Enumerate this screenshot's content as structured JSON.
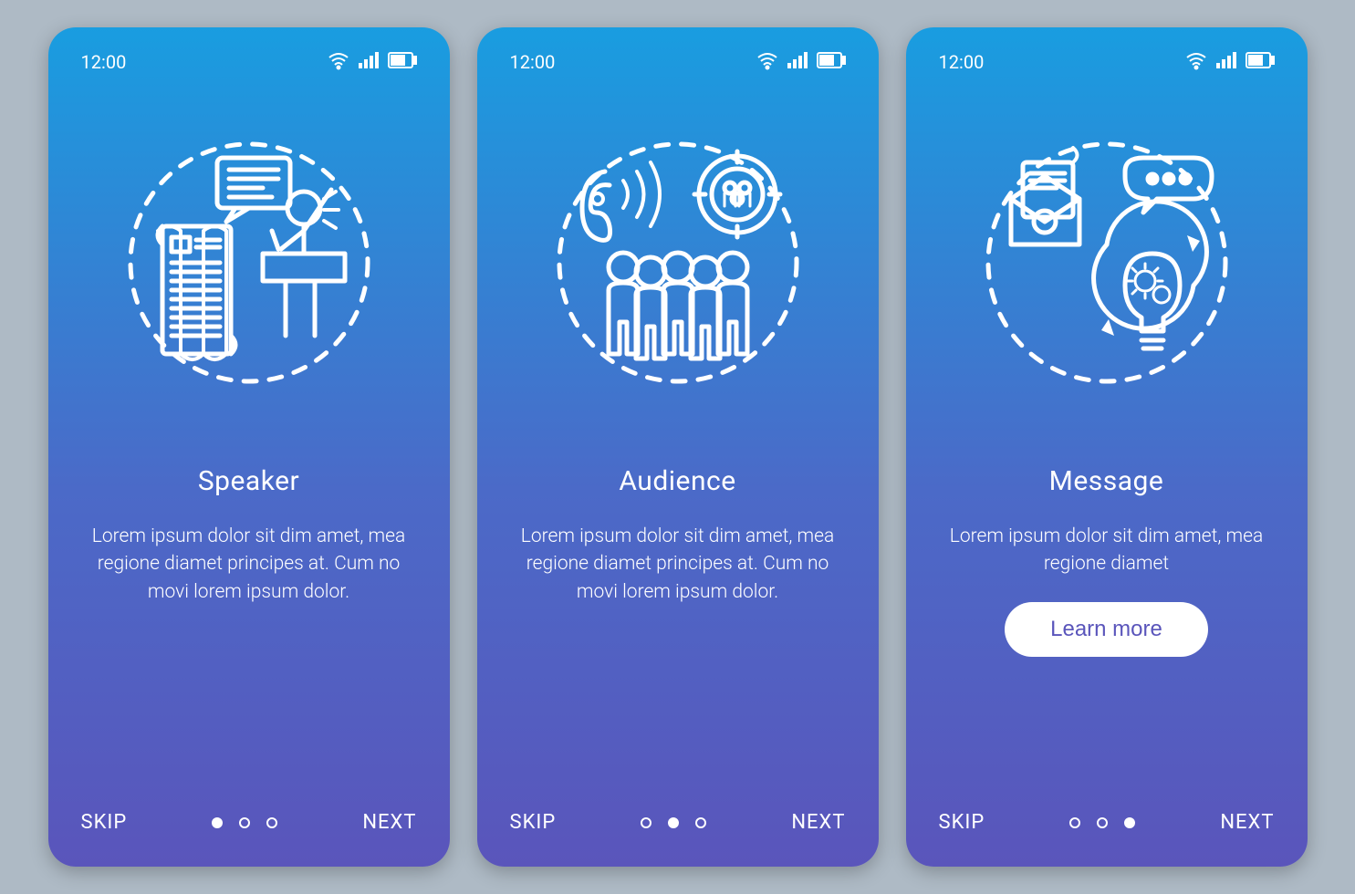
{
  "status": {
    "time": "12:00",
    "wifi_icon": "wifi-icon",
    "signal_icon": "signal-icon",
    "battery_icon": "battery-icon"
  },
  "screens": [
    {
      "title": "Speaker",
      "desc": "Lorem ipsum dolor sit dim amet, mea regione diamet principes at. Cum no movi lorem ipsum dolor.",
      "skip": "SKIP",
      "next": "NEXT",
      "active_dot": 0,
      "learn_more": null,
      "illustration": "speaker"
    },
    {
      "title": "Audience",
      "desc": "Lorem ipsum dolor sit dim amet, mea regione diamet principes at. Cum no movi lorem ipsum dolor.",
      "skip": "SKIP",
      "next": "NEXT",
      "active_dot": 1,
      "learn_more": null,
      "illustration": "audience"
    },
    {
      "title": "Message",
      "desc": "Lorem ipsum dolor sit dim amet, mea regione diamet",
      "skip": "SKIP",
      "next": "NEXT",
      "active_dot": 2,
      "learn_more": "Learn more",
      "illustration": "message"
    }
  ],
  "colors": {
    "gradient_top": "#199de0",
    "gradient_bottom": "#5a55bb",
    "page_bg": "#aebac5",
    "button_bg": "#ffffff",
    "button_text": "#5a55bb"
  }
}
